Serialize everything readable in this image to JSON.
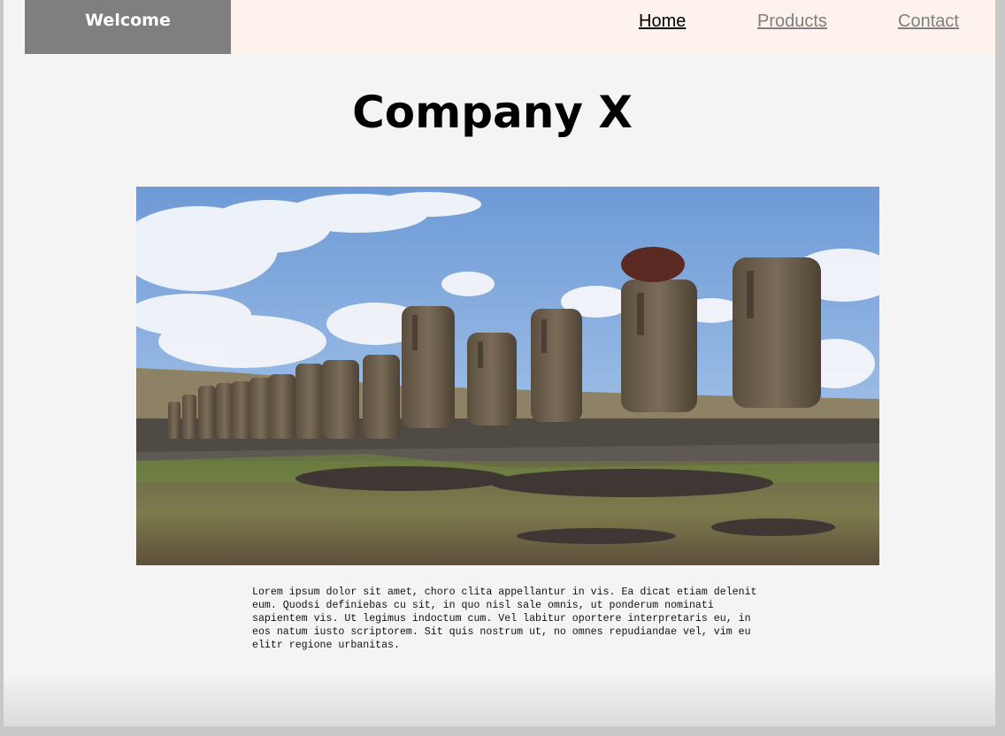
{
  "nav": {
    "welcome": "Welcome",
    "links": [
      "Home",
      "Products",
      "Contact"
    ]
  },
  "main": {
    "title": "Company X",
    "paragraph": "Lorem ipsum dolor sit amet, choro clita appellantur in vis. Ea dicat etiam delenit eum. Quodsi definiebas cu sit, in quo nisl sale omnis, ut ponderum nominati sapientem vis. Ut legimus indoctum cum. Vel labitur oportere interpretaris eu, in eos natum iusto scriptorem. Sit quis nostrum ut, no omnes repudiandae vel, vim eu elitr regione urbanitas."
  },
  "colors": {
    "navbar_bg": "#fdf2ec",
    "welcome_bg": "#7f7f7f",
    "page_bg": "#f4f4f4",
    "link_active": "#000000",
    "link_inactive": "#7f7f7f"
  }
}
